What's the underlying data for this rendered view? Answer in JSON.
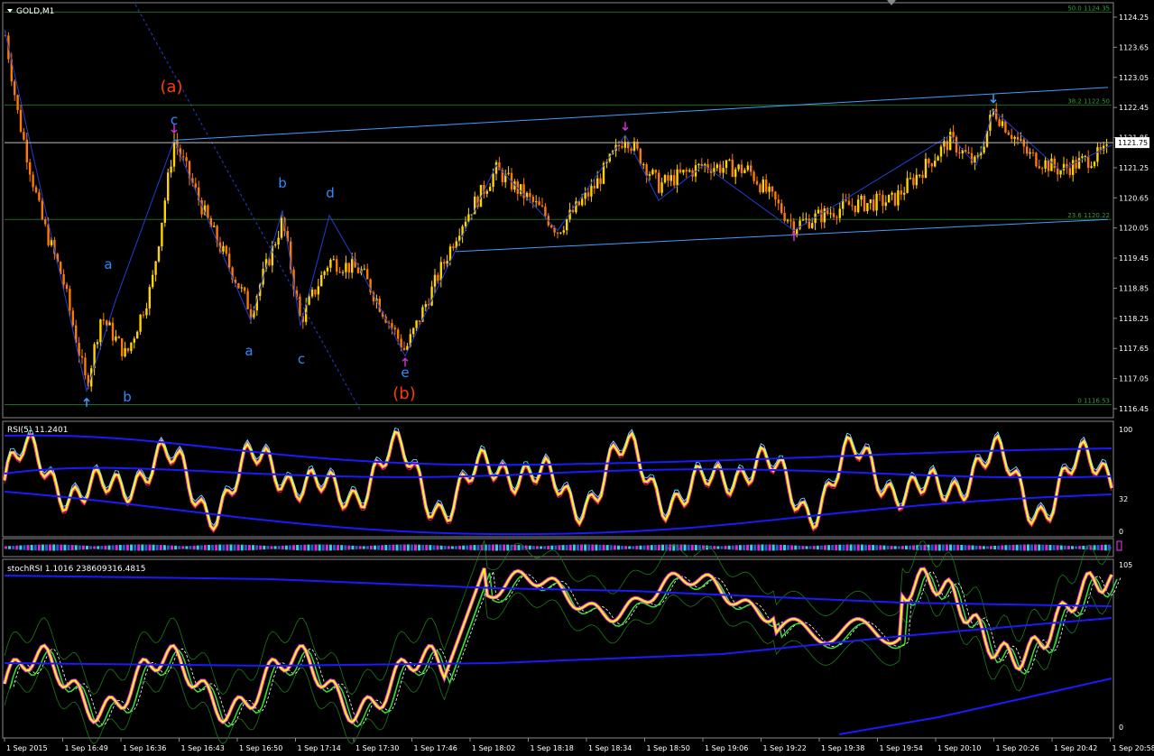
{
  "chart_data": [
    {
      "type": "candlestick",
      "title": "GOLD,M1",
      "symbol": "GOLD",
      "timeframe": "M1",
      "current_price": "1121.75",
      "y_ticks": [
        "1124.25",
        "1123.65",
        "1123.05",
        "1122.45",
        "1121.85",
        "1121.25",
        "1120.65",
        "1120.05",
        "1119.45",
        "1118.85",
        "1118.25",
        "1117.65",
        "1117.05",
        "1116.45"
      ],
      "ylim": [
        1116.45,
        1124.25
      ],
      "fib_levels": [
        {
          "label": "50.0 1124.35",
          "value": 1124.35
        },
        {
          "label": "38.2 1122.50",
          "value": 1122.5
        },
        {
          "label": "23.6 1120.22",
          "value": 1120.22
        },
        {
          "label": "0 1116.53",
          "value": 1116.53
        }
      ],
      "wave_labels": [
        {
          "text": "(a)",
          "color": "#ff3d00"
        },
        {
          "text": "c",
          "color": "#2f8cff"
        },
        {
          "text": "a",
          "color": "#2f8cff"
        },
        {
          "text": "b",
          "color": "#2f8cff"
        },
        {
          "text": "b",
          "color": "#2f8cff"
        },
        {
          "text": "d",
          "color": "#2f8cff"
        },
        {
          "text": "a",
          "color": "#2f8cff"
        },
        {
          "text": "c",
          "color": "#2f8cff"
        },
        {
          "text": "e",
          "color": "#2f8cff"
        },
        {
          "text": "(b)",
          "color": "#ff3d00"
        }
      ],
      "colors": {
        "bull": "#ffd400",
        "bear": "#ff7a00",
        "grid": "#1e6b1e",
        "zigzag": "#1f3fd6",
        "channel": "#3aa0ff"
      }
    },
    {
      "type": "line",
      "title": "RSI(5) 11.2401",
      "y_ticks": [
        "100",
        "32",
        "0"
      ],
      "ylim": [
        0,
        100
      ],
      "colors": {
        "main": "#ffff00",
        "highlight": "#ff33ff",
        "signal": "#ff2222",
        "aux": "#55ffff",
        "bands": "#1a1aff"
      }
    },
    {
      "type": "histogram",
      "title": "",
      "colors": {
        "a": "#ff33ff",
        "b": "#33ffff",
        "c": "#3366ff"
      }
    },
    {
      "type": "line",
      "title": "stochRSI 1.1016 238609316.4815",
      "y_ticks": [
        "105",
        "0"
      ],
      "ylim": [
        0,
        105
      ],
      "colors": {
        "main": "#ffff00",
        "highlight": "#ff33ff",
        "signal": "#33dd33",
        "dashed": "#ffffff",
        "envelope": "#1a7a1a",
        "bands": "#1a1aff"
      }
    }
  ],
  "time_axis": {
    "labels": [
      "1 Sep 2015",
      "1 Sep 16:49",
      "1 Sep 16:36",
      "1 Sep 16:43",
      "1 Sep 16:50",
      "1 Sep 17:14",
      "1 Sep 17:30",
      "1 Sep 17:46",
      "1 Sep 18:02",
      "1 Sep 18:18",
      "1 Sep 18:34",
      "1 Sep 18:50",
      "1 Sep 19:06",
      "1 Sep 19:22",
      "1 Sep 19:38",
      "1 Sep 19:54",
      "1 Sep 20:10",
      "1 Sep 20:26",
      "1 Sep 20:42",
      "1 Sep 20:58"
    ]
  }
}
